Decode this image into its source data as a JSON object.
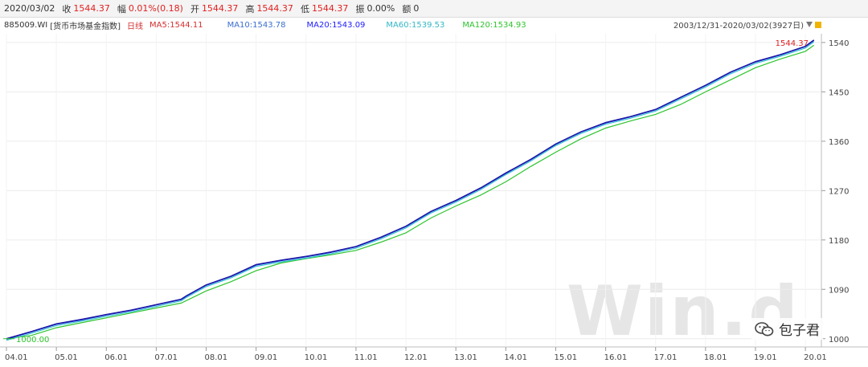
{
  "quote": {
    "date": "2020/03/02",
    "close_label": "收",
    "close": "1544.37",
    "change_label": "幅",
    "change": "0.01%(0.18)",
    "open_label": "开",
    "open": "1544.37",
    "high_label": "高",
    "high": "1544.37",
    "low_label": "低",
    "low": "1544.37",
    "amplitude_label": "振",
    "amplitude": "0.00%",
    "amount_label": "额",
    "amount": "0"
  },
  "ma": {
    "code": "885009.WI",
    "name": "[货币市场基金指数]",
    "period": "日线",
    "ma5": "MA5:1544.11",
    "ma10": "MA10:1543.78",
    "ma20": "MA20:1543.09",
    "ma60": "MA60:1539.53",
    "ma120": "MA120:1534.93"
  },
  "range": {
    "label": "2003/12/31-2020/03/02(3927日)"
  },
  "watermark": "Win.d",
  "wechat_label": "包子君",
  "colors": {
    "price": "#1a1aa6",
    "ma5": "#d43030",
    "ma10": "#7d7de8",
    "ma20": "#2020ff",
    "ma60": "#33c3d0",
    "ma120": "#2ec42e",
    "up": "#e02020"
  },
  "chart_data": {
    "type": "line",
    "x_ticks": [
      "04.01",
      "05.01",
      "06.01",
      "07.01",
      "08.01",
      "09.01",
      "10.01",
      "11.01",
      "12.01",
      "13.01",
      "14.01",
      "15.01",
      "16.01",
      "17.01",
      "18.01",
      "19.01",
      "20.01"
    ],
    "y_ticks": [
      1540,
      1450,
      1360,
      1270,
      1180,
      1090,
      1000
    ],
    "ylim": [
      985,
      1556
    ],
    "start_annotation": "1000.00",
    "end_annotation": "1544.37",
    "series": [
      {
        "name": "885009.WI",
        "x": [
          2004.0,
          2004.5,
          2005.0,
          2005.5,
          2006.0,
          2006.5,
          2007.0,
          2007.5,
          2007.6,
          2008.0,
          2008.5,
          2009.0,
          2009.5,
          2010.0,
          2010.5,
          2011.0,
          2011.5,
          2012.0,
          2012.5,
          2013.0,
          2013.5,
          2014.0,
          2014.5,
          2015.0,
          2015.5,
          2016.0,
          2016.5,
          2017.0,
          2017.5,
          2018.0,
          2018.5,
          2019.0,
          2019.5,
          2020.0,
          2020.17
        ],
        "values": [
          1000.0,
          1013.0,
          1027.0,
          1035.0,
          1044.0,
          1052.0,
          1062.0,
          1072.0,
          1078.0,
          1098.0,
          1114.0,
          1135.0,
          1143.0,
          1150.0,
          1158.0,
          1168.0,
          1185.0,
          1205.0,
          1232.0,
          1252.0,
          1275.0,
          1302.0,
          1327.0,
          1355.0,
          1377.0,
          1394.0,
          1405.0,
          1418.0,
          1440.0,
          1462.0,
          1486.0,
          1505.0,
          1518.0,
          1533.0,
          1544.37
        ]
      },
      {
        "name": "MA120",
        "x": [
          2004.0,
          2004.5,
          2005.0,
          2005.5,
          2006.0,
          2006.5,
          2007.0,
          2007.5,
          2008.0,
          2008.5,
          2009.0,
          2009.5,
          2010.0,
          2010.5,
          2011.0,
          2011.5,
          2012.0,
          2012.5,
          2013.0,
          2013.5,
          2014.0,
          2014.5,
          2015.0,
          2015.5,
          2016.0,
          2016.5,
          2017.0,
          2017.5,
          2018.0,
          2018.5,
          2019.0,
          2019.5,
          2020.0,
          2020.17
        ],
        "values": [
          1000.0,
          1006.0,
          1020.0,
          1029.0,
          1038.0,
          1047.0,
          1056.0,
          1065.0,
          1087.0,
          1104.0,
          1124.0,
          1138.0,
          1146.0,
          1153.0,
          1161.0,
          1176.0,
          1193.0,
          1220.0,
          1242.0,
          1262.0,
          1286.0,
          1314.0,
          1340.0,
          1364.0,
          1384.0,
          1397.0,
          1409.0,
          1427.0,
          1450.0,
          1472.0,
          1494.0,
          1510.0,
          1524.0,
          1534.93
        ]
      }
    ]
  }
}
